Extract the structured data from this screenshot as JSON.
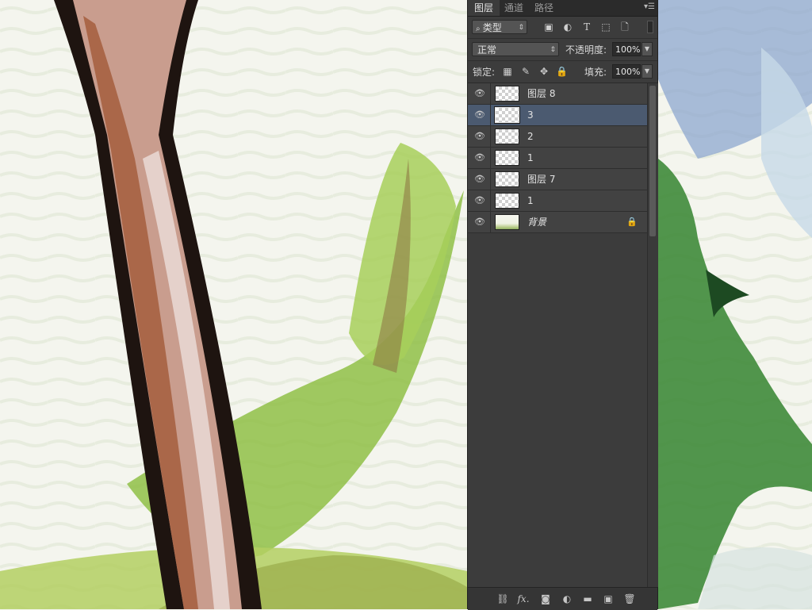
{
  "panel": {
    "tabs": [
      {
        "label": "图层",
        "active": true
      },
      {
        "label": "通道",
        "active": false
      },
      {
        "label": "路径",
        "active": false
      }
    ],
    "menu_icon": "panel-menu-icon",
    "filter": {
      "label": "类型",
      "icons": [
        "image-filter-icon",
        "adjustment-filter-icon",
        "type-filter-icon",
        "shape-filter-icon",
        "smart-object-filter-icon"
      ]
    },
    "blend": {
      "mode": "正常",
      "opacity_label": "不透明度:",
      "opacity_value": "100%"
    },
    "lock": {
      "label": "锁定:",
      "icons": [
        "lock-transparent-icon",
        "lock-paint-icon",
        "lock-position-icon",
        "lock-all-icon"
      ],
      "fill_label": "填充:",
      "fill_value": "100%"
    },
    "layers": [
      {
        "name": "图层 8",
        "visible": true,
        "selected": false,
        "locked": false
      },
      {
        "name": "3",
        "visible": true,
        "selected": true,
        "locked": false
      },
      {
        "name": "2",
        "visible": true,
        "selected": false,
        "locked": false
      },
      {
        "name": "1",
        "visible": true,
        "selected": false,
        "locked": false
      },
      {
        "name": "图层 7",
        "visible": true,
        "selected": false,
        "locked": false
      },
      {
        "name": "1",
        "visible": true,
        "selected": false,
        "locked": false
      },
      {
        "name": "背景",
        "visible": true,
        "selected": false,
        "locked": true
      }
    ],
    "footer_icons": [
      "link-layers-icon",
      "fx-icon",
      "add-mask-icon",
      "new-adjustment-icon",
      "new-group-icon",
      "new-layer-icon",
      "delete-layer-icon"
    ],
    "footer_fx_label": "fx."
  },
  "colors": {
    "panel_bg": "#3c3c3c",
    "selected_layer": "#4b5a70",
    "canvas_bg": "#f3f4ec"
  }
}
